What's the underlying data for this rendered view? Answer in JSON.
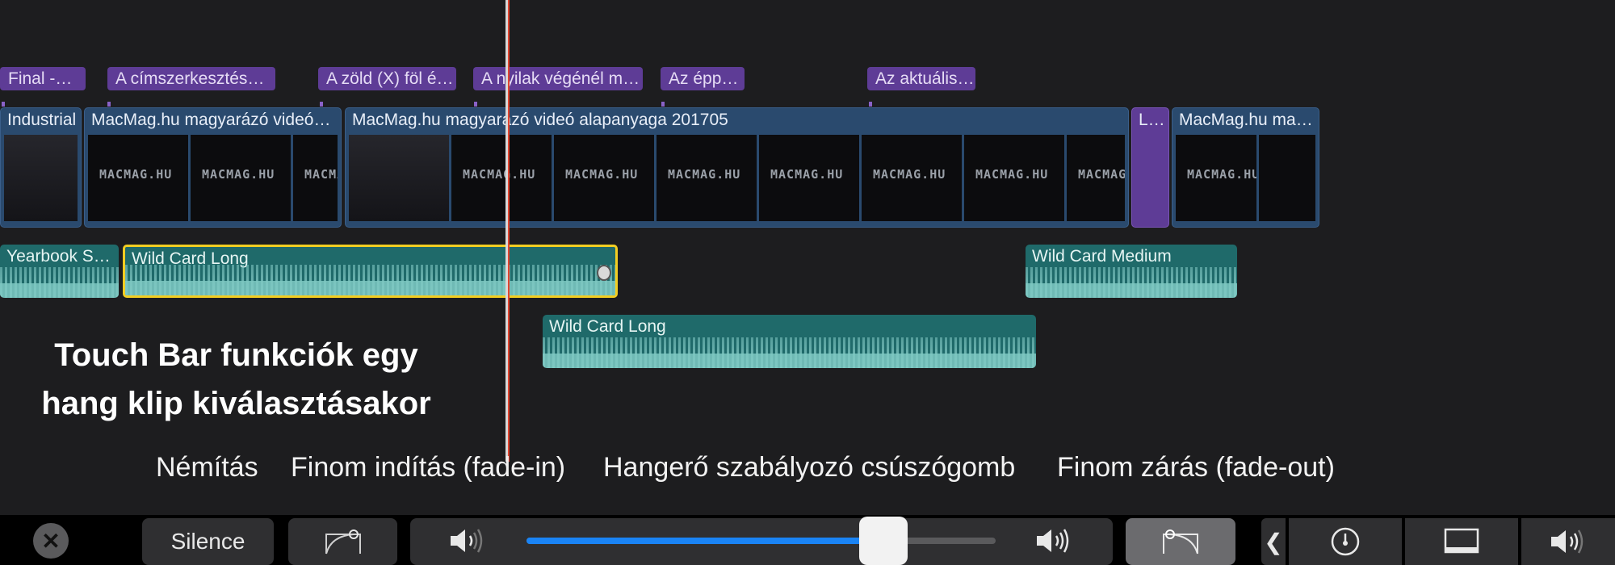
{
  "markers": [
    "Final  -…",
    "A címszerkesztés…",
    "A zöld (X) föl é…",
    "A nyilak végénél m…",
    "Az épp…",
    "Az aktuális…"
  ],
  "video_clips": [
    {
      "title": "Industrial"
    },
    {
      "title": "MacMag.hu magyarázó videó…"
    },
    {
      "title": "MacMag.hu magyarázó videó alapanyaga 201705"
    },
    {
      "title": "L…"
    },
    {
      "title": "MacMag.hu ma…"
    }
  ],
  "thumb_text": "MACMAG.HU",
  "audio_clips": [
    {
      "title": "Yearbook S…"
    },
    {
      "title": "Wild Card Long",
      "selected": true
    },
    {
      "title": "Wild Card Medium"
    },
    {
      "title": "Wild Card Long"
    }
  ],
  "caption": {
    "line1": "Touch Bar funkciók egy",
    "line2": "hang klip kiválasztásakor"
  },
  "labels": {
    "mute": "Némítás",
    "fade_in": "Finom indítás (fade-in)",
    "volume_slider": "Hangerő szabályozó csúszógomb",
    "fade_out": "Finom zárás (fade-out)"
  },
  "touchbar": {
    "close": "✕",
    "silence": "Silence",
    "volume_level": 0.76,
    "chevron": "❮"
  },
  "colors": {
    "marker": "#5e3c96",
    "video_clip": "#2a4a6e",
    "audio_clip": "#1f6a6a",
    "selection": "#f2cd22",
    "playhead": "#e0442f",
    "slider_fill": "#1a84f5"
  }
}
